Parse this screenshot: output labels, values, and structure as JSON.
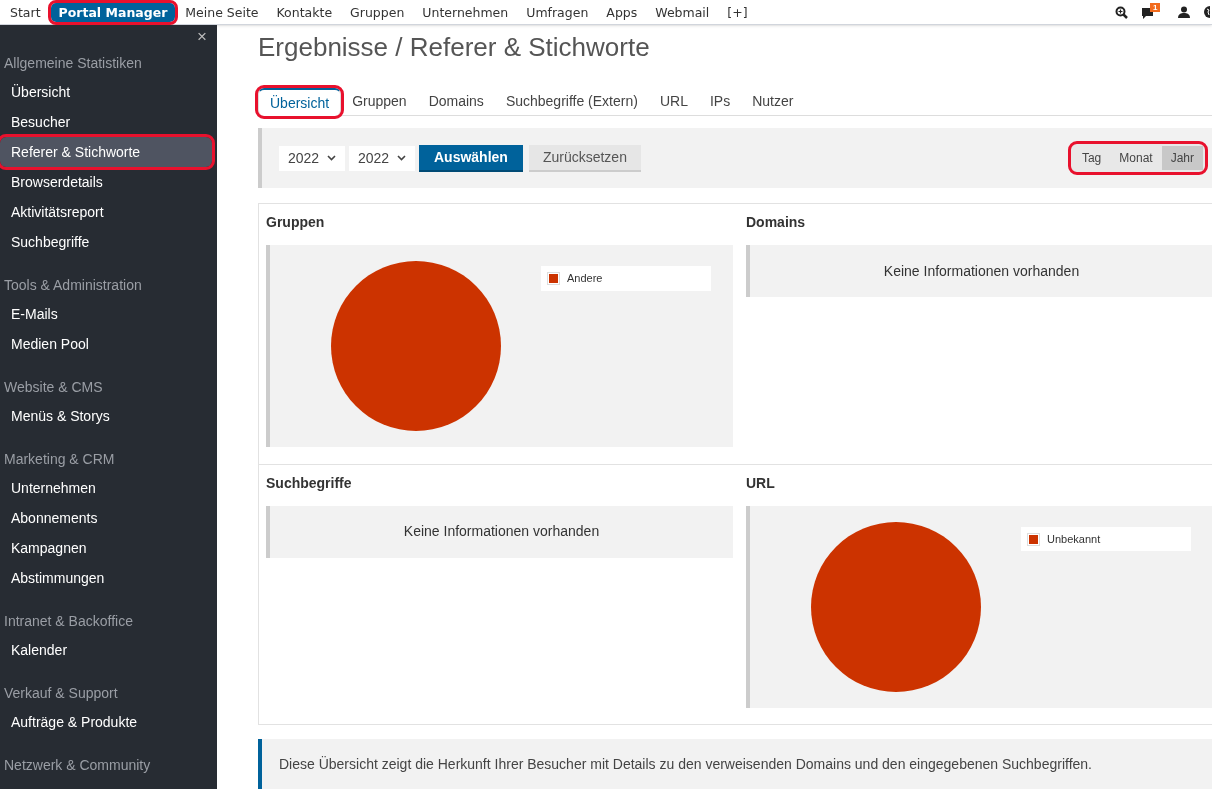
{
  "top_nav": {
    "items": [
      {
        "label": "Start",
        "selected": false,
        "annotated": false
      },
      {
        "label": "Portal Manager",
        "selected": true,
        "annotated": true
      },
      {
        "label": "Meine Seite",
        "selected": false,
        "annotated": false
      },
      {
        "label": "Kontakte",
        "selected": false,
        "annotated": false
      },
      {
        "label": "Gruppen",
        "selected": false,
        "annotated": false
      },
      {
        "label": "Unternehmen",
        "selected": false,
        "annotated": false
      },
      {
        "label": "Umfragen",
        "selected": false,
        "annotated": false
      },
      {
        "label": "Apps",
        "selected": false,
        "annotated": false
      },
      {
        "label": "Webmail",
        "selected": false,
        "annotated": false
      },
      {
        "label": "[+]",
        "selected": false,
        "annotated": false
      }
    ],
    "message_badge": "1"
  },
  "sidebar": {
    "close": "×",
    "groups": [
      {
        "title": "Allgemeine Statistiken",
        "items": [
          {
            "label": "Übersicht",
            "selected": false,
            "annotated": false
          },
          {
            "label": "Besucher",
            "selected": false,
            "annotated": false
          },
          {
            "label": "Referer & Stichworte",
            "selected": true,
            "annotated": true
          },
          {
            "label": "Browserdetails",
            "selected": false,
            "annotated": false
          },
          {
            "label": "Aktivitätsreport",
            "selected": false,
            "annotated": false
          },
          {
            "label": "Suchbegriffe",
            "selected": false,
            "annotated": false
          }
        ]
      },
      {
        "title": "Tools & Administration",
        "items": [
          {
            "label": "E-Mails",
            "selected": false,
            "annotated": false
          },
          {
            "label": "Medien Pool",
            "selected": false,
            "annotated": false
          }
        ]
      },
      {
        "title": "Website & CMS",
        "items": [
          {
            "label": "Menüs & Storys",
            "selected": false,
            "annotated": false
          }
        ]
      },
      {
        "title": "Marketing & CRM",
        "items": [
          {
            "label": "Unternehmen",
            "selected": false,
            "annotated": false
          },
          {
            "label": "Abonnements",
            "selected": false,
            "annotated": false
          },
          {
            "label": "Kampagnen",
            "selected": false,
            "annotated": false
          },
          {
            "label": "Abstimmungen",
            "selected": false,
            "annotated": false
          }
        ]
      },
      {
        "title": "Intranet & Backoffice",
        "items": [
          {
            "label": "Kalender",
            "selected": false,
            "annotated": false
          }
        ]
      },
      {
        "title": "Verkauf & Support",
        "items": [
          {
            "label": "Aufträge & Produkte",
            "selected": false,
            "annotated": false
          }
        ]
      },
      {
        "title": "Netzwerk & Community"
      }
    ]
  },
  "page_title": "Ergebnisse / Referer & Stichworte",
  "tabs": [
    {
      "label": "Übersicht",
      "selected": true,
      "annotated": true
    },
    {
      "label": "Gruppen",
      "selected": false,
      "annotated": false
    },
    {
      "label": "Domains",
      "selected": false,
      "annotated": false
    },
    {
      "label": "Suchbegriffe (Extern)",
      "selected": false,
      "annotated": false
    },
    {
      "label": "URL",
      "selected": false,
      "annotated": false
    },
    {
      "label": "IPs",
      "selected": false,
      "annotated": false
    },
    {
      "label": "Nutzer",
      "selected": false,
      "annotated": false
    }
  ],
  "filter": {
    "year_from": "2022",
    "year_to": "2022",
    "select_button": "Auswählen",
    "reset_button": "Zurücksetzen",
    "period": {
      "annotated": true,
      "options": [
        {
          "label": "Tag",
          "selected": false
        },
        {
          "label": "Monat",
          "selected": false
        },
        {
          "label": "Jahr",
          "selected": true
        }
      ]
    }
  },
  "panels": [
    {
      "title": "Gruppen",
      "kind": "pie",
      "legend": [
        {
          "label": "Andere",
          "color": "#cc3300"
        }
      ]
    },
    {
      "title": "Domains",
      "kind": "empty",
      "message": "Keine Informationen vorhanden"
    },
    {
      "title": "Suchbegriffe",
      "kind": "empty",
      "message": "Keine Informationen vorhanden"
    },
    {
      "title": "URL",
      "kind": "pie",
      "legend": [
        {
          "label": "Unbekannt",
          "color": "#cc3300"
        }
      ]
    }
  ],
  "info": "Diese Übersicht zeigt die Herkunft Ihrer Besucher mit Details zu den verweisenden Domains und den eingegebenen Suchbegriffen."
}
